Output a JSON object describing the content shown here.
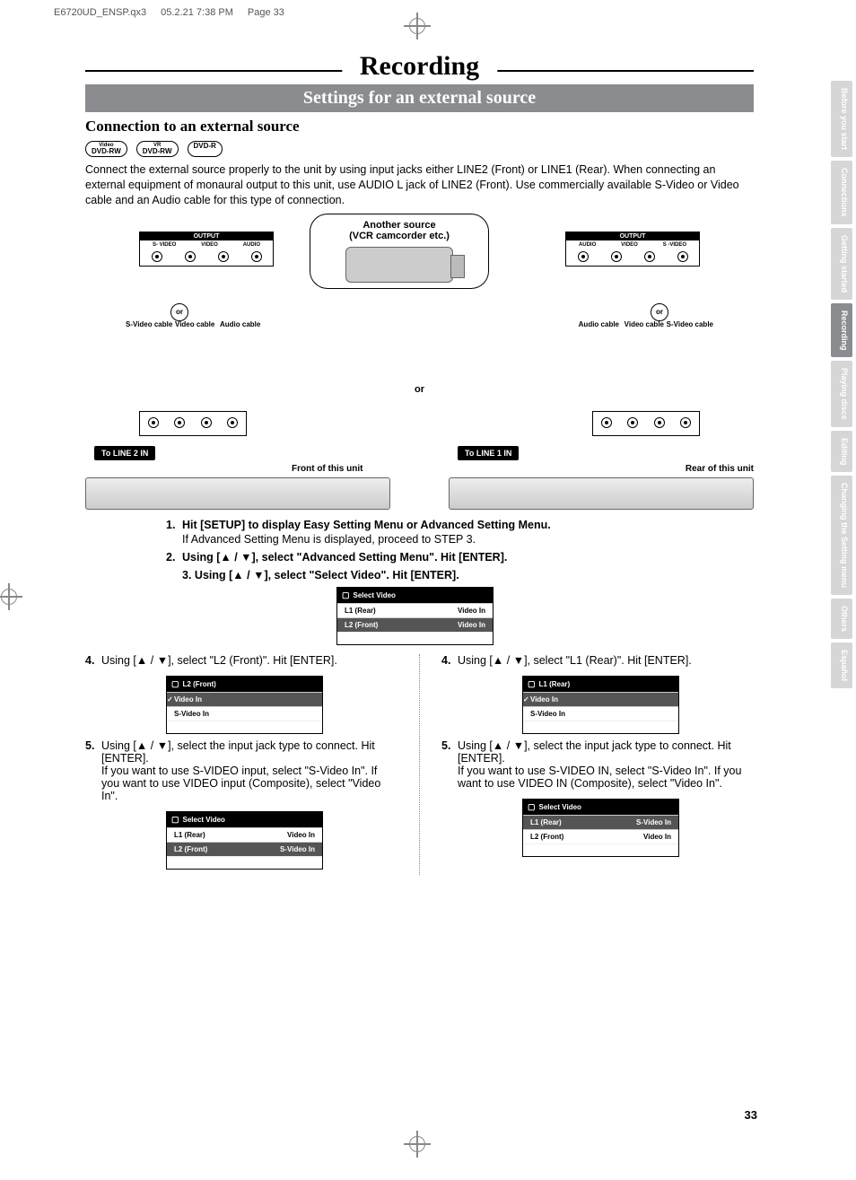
{
  "print_header": {
    "file": "E6720UD_ENSP.qx3",
    "timestamp": "05.2.21 7:38 PM",
    "page": "Page 33"
  },
  "title": "Recording",
  "section_bar": "Settings for an external source",
  "subsection": "Connection to an external source",
  "disc_badges": [
    {
      "top": "Video",
      "main": "DVD-RW"
    },
    {
      "top": "VR",
      "main": "DVD-RW"
    },
    {
      "top": "",
      "main": "DVD-R"
    }
  ],
  "intro": "Connect the external source properly to the unit by using input jacks either LINE2 (Front) or LINE1 (Rear). When connecting an external equipment of monaural output to this unit, use AUDIO L jack of LINE2 (Front). Use commercially available S-Video or Video cable and an Audio cable for this type of connection.",
  "diagram": {
    "source_box_line1": "Another source",
    "source_box_line2": "(VCR camcorder etc.)",
    "output_label": "OUTPUT",
    "jack_labels_left": [
      "S- VIDEO",
      "VIDEO",
      "AUDIO"
    ],
    "jack_labels_right": [
      "AUDIO",
      "VIDEO",
      "S -VIDEO"
    ],
    "cable_labels": [
      "S-Video cable",
      "Video cable",
      "Audio cable"
    ],
    "or": "or",
    "to_line2": "To LINE 2 IN",
    "to_line1": "To LINE 1 IN",
    "front": "Front of this unit",
    "rear": "Rear of this unit"
  },
  "steps_top": [
    {
      "n": "1.",
      "bold": "Hit [SETUP] to display Easy Setting Menu or Advanced Setting Menu.",
      "sub": "If Advanced Setting Menu is displayed, proceed to STEP 3."
    },
    {
      "n": "2.",
      "bold": "Using [▲ / ▼], select \"Advanced Setting Menu\". Hit [ENTER]."
    }
  ],
  "step3": {
    "n": "3.",
    "bold": "Using [▲ / ▼], select \"Select Video\". Hit [ENTER]."
  },
  "osd_select_video": {
    "title": "Select Video",
    "rows": [
      {
        "left": "L1 (Rear)",
        "right": "Video In",
        "hl": false
      },
      {
        "left": "L2 (Front)",
        "right": "Video In",
        "hl": true
      }
    ]
  },
  "left_col": {
    "step4": "Using [▲ / ▼], select \"L2 (Front)\". Hit [ENTER].",
    "osd_l2": {
      "title": "L2 (Front)",
      "rows": [
        {
          "left": "Video In",
          "check": true,
          "hl": true
        },
        {
          "left": "S-Video In",
          "check": false,
          "hl": false
        }
      ]
    },
    "step5_bold": "Using [▲ / ▼], select the input jack type to connect. Hit [ENTER].",
    "step5_body": "If you want to use S-VIDEO input, select \"S-Video In\". If you want to use VIDEO input (Composite), select \"Video In\".",
    "osd_result": {
      "title": "Select Video",
      "rows": [
        {
          "left": "L1 (Rear)",
          "right": "Video In",
          "hl": false
        },
        {
          "left": "L2 (Front)",
          "right": "S-Video In",
          "hl": true
        }
      ]
    }
  },
  "right_col": {
    "step4": "Using [▲ / ▼], select \"L1 (Rear)\". Hit [ENTER].",
    "osd_l1": {
      "title": "L1 (Rear)",
      "rows": [
        {
          "left": "Video In",
          "check": true,
          "hl": true
        },
        {
          "left": "S-Video In",
          "check": false,
          "hl": false
        }
      ]
    },
    "step5_bold": "Using [▲ / ▼], select the input jack type to connect. Hit [ENTER].",
    "step5_body": "If you want to use S-VIDEO IN, select \"S-Video In\". If you want to use VIDEO IN (Composite), select \"Video In\".",
    "osd_result": {
      "title": "Select Video",
      "rows": [
        {
          "left": "L1 (Rear)",
          "right": "S-Video In",
          "hl": true
        },
        {
          "left": "L2 (Front)",
          "right": "Video In",
          "hl": false
        }
      ]
    }
  },
  "tabs": [
    {
      "label": "Before you start",
      "active": false
    },
    {
      "label": "Connections",
      "active": false
    },
    {
      "label": "Getting started",
      "active": false
    },
    {
      "label": "Recording",
      "active": true
    },
    {
      "label": "Playing discs",
      "active": false
    },
    {
      "label": "Editing",
      "active": false
    },
    {
      "label": "Changing the Setting menu",
      "active": false
    },
    {
      "label": "Others",
      "active": false
    },
    {
      "label": "Español",
      "active": false
    }
  ],
  "page_number": "33"
}
